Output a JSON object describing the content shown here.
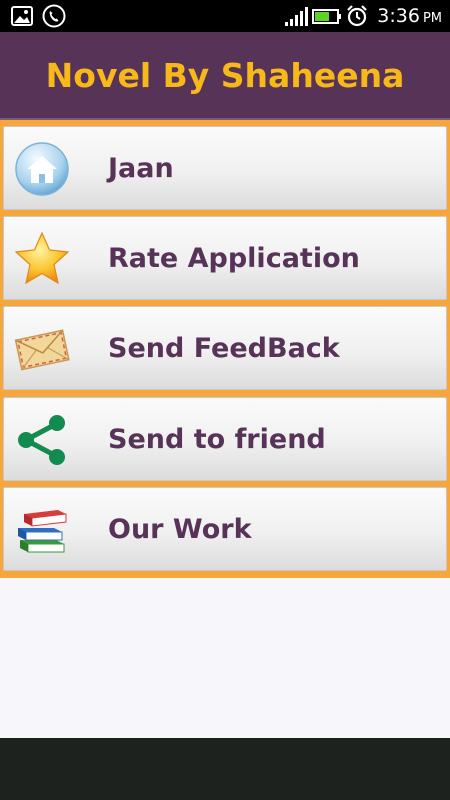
{
  "status_bar": {
    "time": "3:36",
    "ampm": "PM",
    "icons": [
      "gallery-icon",
      "phone-call-icon",
      "signal-icon",
      "battery-icon",
      "alarm-icon"
    ]
  },
  "header": {
    "title": "Novel By Shaheena",
    "title_color": "#f7b81a",
    "background": "#573358"
  },
  "menu": {
    "background": "#f6a63a",
    "label_color": "#573358",
    "items": [
      {
        "label": "Jaan",
        "icon": "home-icon"
      },
      {
        "label": "Rate Application",
        "icon": "star-icon"
      },
      {
        "label": "Send FeedBack",
        "icon": "envelope-icon"
      },
      {
        "label": "Send to friend",
        "icon": "share-icon"
      },
      {
        "label": "Our Work",
        "icon": "books-icon"
      }
    ]
  }
}
